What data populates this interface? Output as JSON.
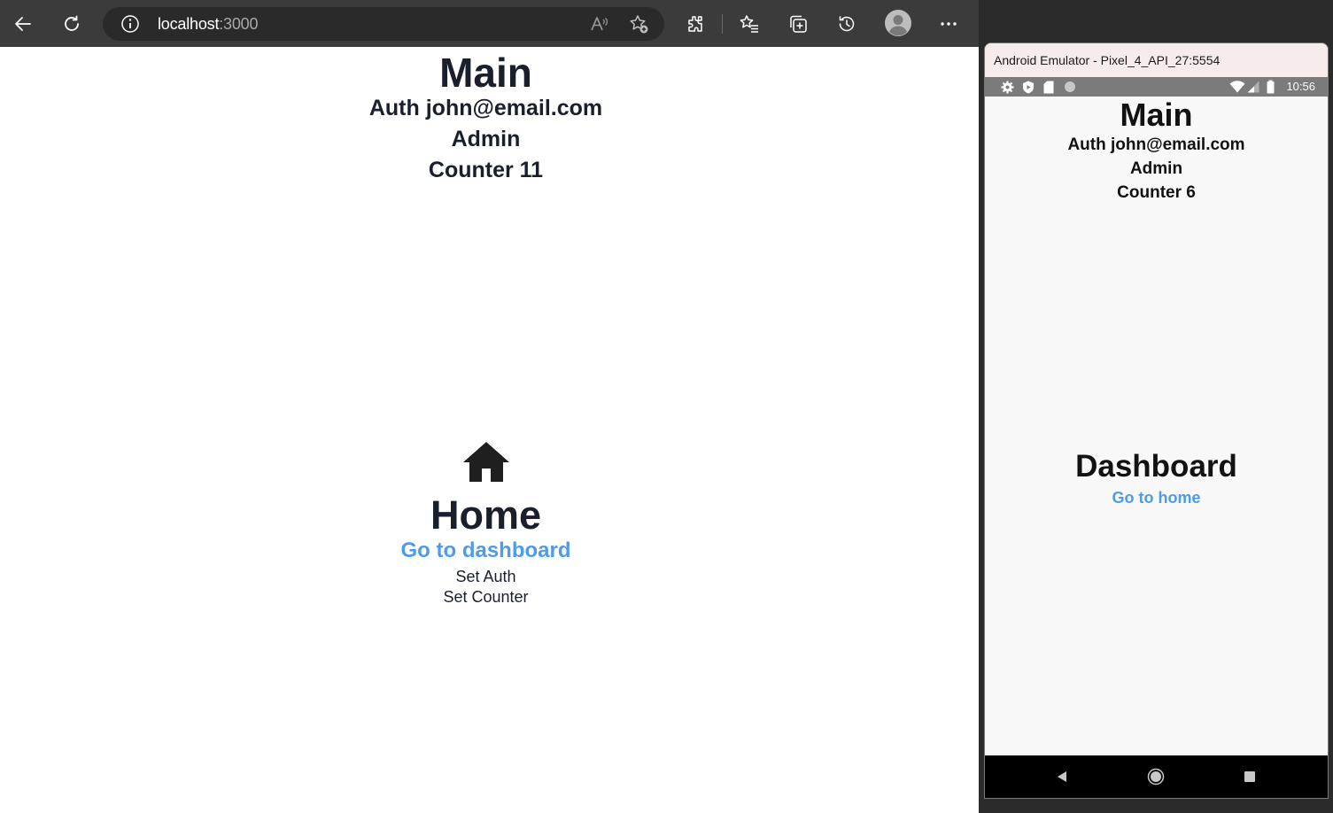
{
  "browser": {
    "address": {
      "host": "localhost",
      "port": ":3000"
    },
    "toolbar_icons": [
      "back-arrow-icon",
      "refresh-icon",
      "site-info-icon",
      "read-aloud-icon",
      "add-favorite-icon",
      "extensions-icon",
      "favorites-icon",
      "collections-icon",
      "history-icon",
      "profile-icon",
      "more-icon"
    ]
  },
  "web_page": {
    "main_title": "Main",
    "auth_text": "Auth john@email.com",
    "role_text": "Admin",
    "counter_text": "Counter 11",
    "home_title": "Home",
    "dashboard_link": "Go to dashboard",
    "set_auth": "Set Auth",
    "set_counter": "Set Counter"
  },
  "emulator": {
    "window_title": "Android Emulator - Pixel_4_API_27:5554",
    "status_time": "10:56",
    "main_title": "Main",
    "auth_text": "Auth john@email.com",
    "role_text": "Admin",
    "counter_text": "Counter 6",
    "dashboard_title": "Dashboard",
    "home_link": "Go to home"
  },
  "colors": {
    "link": "#4f9be8",
    "heading": "#1a1f2c",
    "browser_toolbar": "#3b3b3b",
    "emulator_statusbar": "#7b7b7b"
  }
}
